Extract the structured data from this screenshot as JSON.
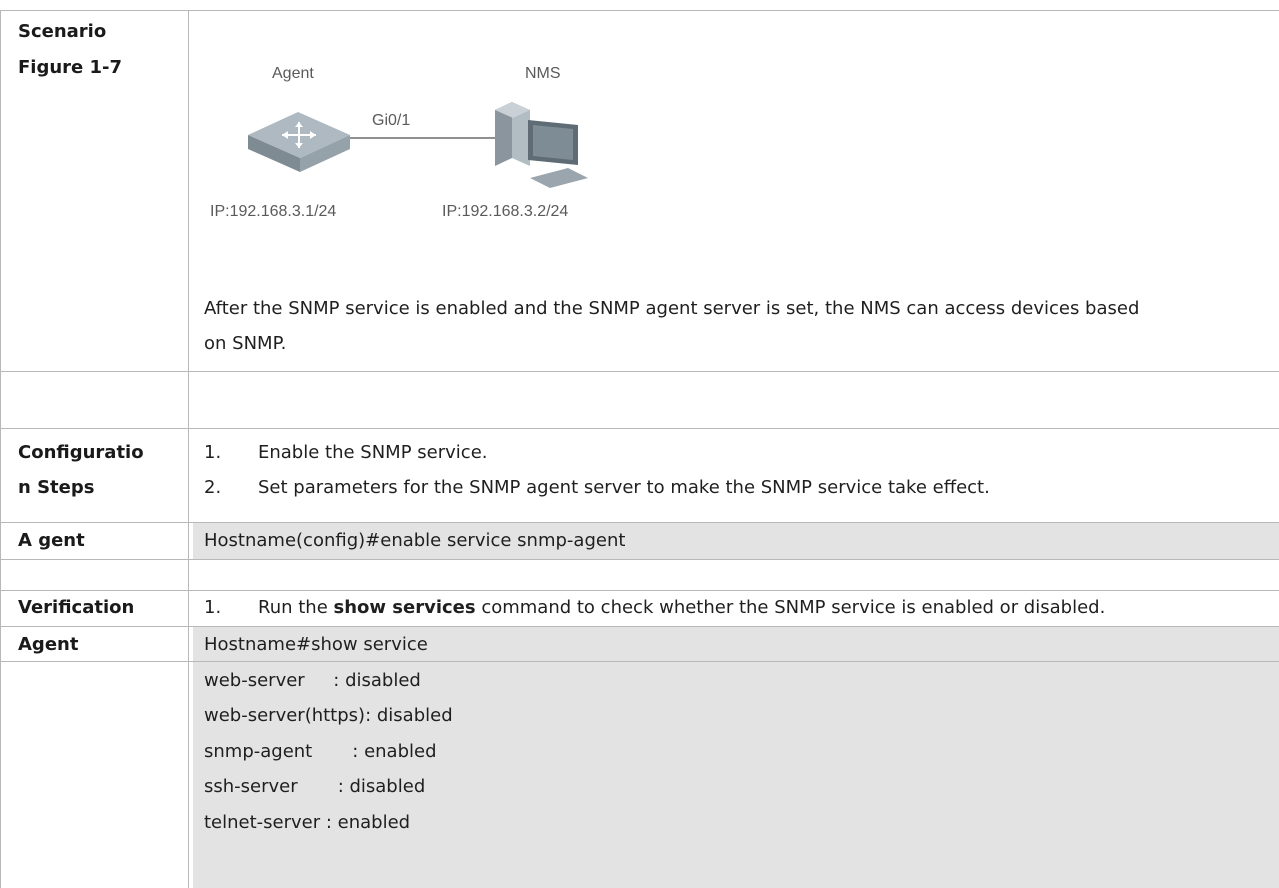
{
  "scenario": {
    "label_line1": "Scenario",
    "label_line2": "Figure 1-7",
    "figure": {
      "agent_label": "Agent",
      "nms_label": "NMS",
      "port_label": "Gi0/1",
      "agent_ip": "IP:192.168.3.1/24",
      "nms_ip": "IP:192.168.3.2/24"
    },
    "description_line1": "After the SNMP service is enabled and the SNMP agent server is set, the NMS can access devices based",
    "description_line2": "on SNMP."
  },
  "config_steps": {
    "label_line1": "Configuratio",
    "label_line2": "n Steps",
    "steps": [
      {
        "num": "1.",
        "text": "Enable the SNMP service."
      },
      {
        "num": "2.",
        "text": "Set parameters for the SNMP agent server to make the SNMP service take effect."
      }
    ]
  },
  "agent_config": {
    "label": "A gent",
    "command": "Hostname(config)#enable service snmp-agent"
  },
  "verification": {
    "label": "Verification",
    "num": "1.",
    "text_before": "Run the ",
    "text_bold": "show services",
    "text_after": " command to check whether the SNMP service is enabled or disabled."
  },
  "agent_output": {
    "label": "Agent",
    "lines": [
      "Hostname#show service",
      "web-server     : disabled",
      "web-server(https): disabled",
      "snmp-agent       : enabled",
      "ssh-server       : disabled",
      "telnet-server : enabled"
    ]
  }
}
